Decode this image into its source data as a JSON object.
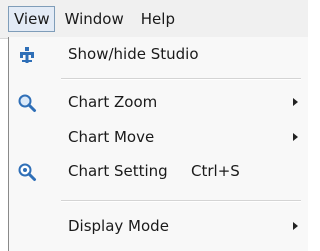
{
  "menubar": {
    "items": [
      {
        "label": "View"
      },
      {
        "label": "Window"
      },
      {
        "label": "Help"
      }
    ]
  },
  "view_menu": {
    "items": [
      {
        "label": "Show/hide Studio",
        "icon": "studio-icon"
      },
      {
        "label": "Chart Zoom",
        "icon": "zoom-icon",
        "submenu": true
      },
      {
        "label": "Chart Move",
        "submenu": true
      },
      {
        "label": "Chart Setting",
        "icon": "chart-setting-icon",
        "shortcut": "Ctrl+S"
      },
      {
        "label": "Display Mode",
        "submenu": true
      }
    ]
  },
  "colors": {
    "menubar_bg": "#f0f0f0",
    "open_menu_highlight": "#e3ebf6",
    "icon_blue": "#2f6fb7"
  }
}
